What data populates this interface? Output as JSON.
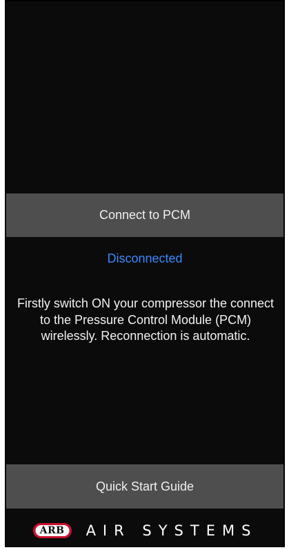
{
  "connect_button": {
    "label": "Connect to PCM"
  },
  "connection_status": {
    "text": "Disconnected",
    "color": "#3a87ff"
  },
  "instructions": {
    "text": "Firstly switch ON your compressor the connect to the Pressure Control Module (PCM) wirelessly. Reconnection is automatic."
  },
  "guide_button": {
    "label": "Quick Start Guide"
  },
  "footer": {
    "logo_text": "ARB",
    "brand_text": "AIR SYSTEMS",
    "logo_color": "#c8102e"
  }
}
